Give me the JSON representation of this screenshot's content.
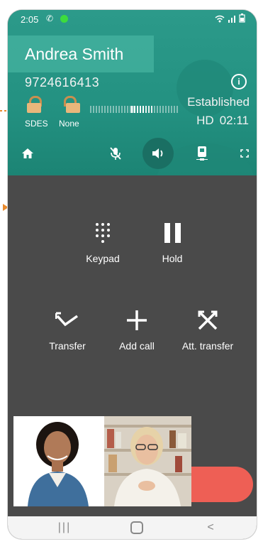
{
  "status_bar": {
    "time": "2:05",
    "call_icon": "phone-icon",
    "indicator_color": "#3ddc3d",
    "right_icons": "wifi-icon signal-icon battery-icon"
  },
  "call": {
    "name": "Andrea Smith",
    "number": "9724616413",
    "state": "Established",
    "quality": "HD",
    "duration": "02:11",
    "encryption_labels": [
      "SDES",
      "None"
    ]
  },
  "toolbar": {
    "icons": [
      "home-icon",
      "mic-off-icon",
      "speaker-icon",
      "device-icon",
      "fullscreen-icon"
    ]
  },
  "actions": {
    "keypad": "Keypad",
    "hold": "Hold",
    "transfer": "Transfer",
    "add_call": "Add call",
    "att_transfer": "Att. transfer"
  },
  "colors": {
    "header": "#239181",
    "background": "#4a4a4a",
    "end_call": "#ee5f55",
    "callout": "#e88a2e"
  },
  "nav": {
    "recent": "|||",
    "back": "<"
  }
}
